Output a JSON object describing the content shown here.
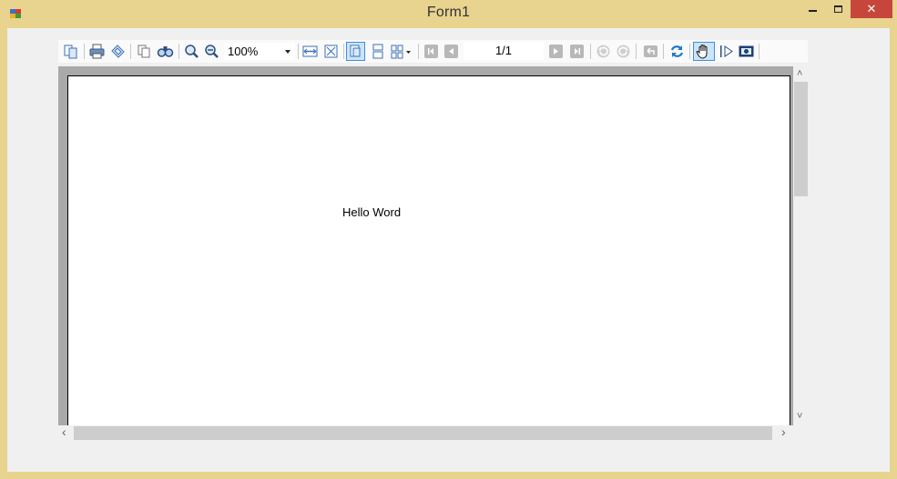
{
  "window": {
    "title": "Form1",
    "close_glyph": "✕",
    "accent_color": "#e8d38f",
    "close_color": "#c7463b"
  },
  "toolbar": {
    "zoom_value": "100%",
    "page_indicator": "1/1",
    "buttons": [
      "document-map-icon",
      "print-icon",
      "page-setup-icon",
      "copy-icon",
      "find-icon",
      "zoom-in-icon",
      "zoom-out-icon",
      "page-width-icon",
      "whole-page-icon",
      "single-page-icon",
      "continuous-icon",
      "multi-page-icon",
      "first-page-icon",
      "prev-page-icon",
      "next-page-icon",
      "last-page-icon",
      "undo-icon",
      "redo-icon",
      "back-icon",
      "refresh-icon",
      "hand-tool-icon",
      "text-select-icon",
      "snapshot-icon"
    ]
  },
  "report": {
    "text": "Hello Word"
  },
  "scroll": {
    "up": "˄",
    "down": "˅",
    "left": "‹",
    "right": "›"
  }
}
